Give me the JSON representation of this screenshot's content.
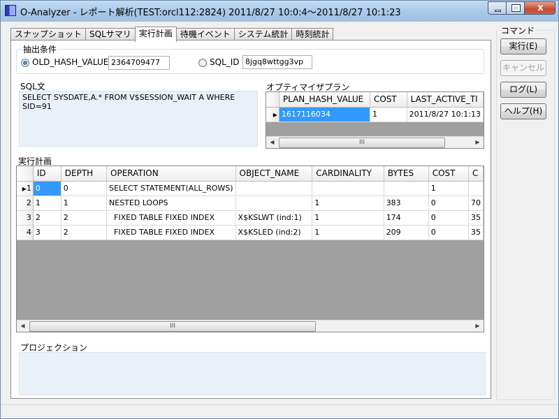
{
  "window": {
    "title": "O-Analyzer - レポート解析(TEST:orcl112:2824) 2011/8/27 10:0:4～2011/8/27 10:1:23",
    "min_glyph": "",
    "close_glyph": "x"
  },
  "tabs": [
    {
      "label": "スナップショット"
    },
    {
      "label": "SQLサマリ"
    },
    {
      "label": "実行計画"
    },
    {
      "label": "待機イベント"
    },
    {
      "label": "システム統計"
    },
    {
      "label": "時刻統計"
    }
  ],
  "conditions": {
    "legend": "抽出条件",
    "old_hash_label": "OLD_HASH_VALUE",
    "old_hash_value": "2364709477",
    "sql_id_label": "SQL_ID",
    "sql_id_value": "8jgq8wttgg3vp"
  },
  "sql": {
    "label": "SQL文",
    "text": "SELECT SYSDATE,A.* FROM V$SESSION_WAIT A WHERE\nSID=91"
  },
  "optimizer_plan": {
    "label": "オプティマイザプラン",
    "columns": [
      "PLAN_HASH_VALUE",
      "COST",
      "LAST_ACTIVE_TI"
    ],
    "rows": [
      {
        "plan_hash_value": "1617116034",
        "cost": "1",
        "last_active": "2011/8/27 10:1:13"
      }
    ]
  },
  "execution_plan": {
    "label": "実行計画",
    "columns": [
      "ID",
      "DEPTH",
      "OPERATION",
      "OBJECT_NAME",
      "CARDINALITY",
      "BYTES",
      "COST",
      "C"
    ],
    "rows": [
      {
        "row": "1",
        "id": "0",
        "depth": "0",
        "operation": "SELECT STATEMENT(ALL_ROWS)",
        "object_name": "",
        "cardinality": "",
        "bytes": "",
        "cost": "1",
        "extra": ""
      },
      {
        "row": "2",
        "id": "1",
        "depth": "1",
        "operation": "NESTED LOOPS",
        "object_name": "",
        "cardinality": "1",
        "bytes": "383",
        "cost": "0",
        "extra": "70"
      },
      {
        "row": "3",
        "id": "2",
        "depth": "2",
        "operation": "FIXED TABLE FIXED INDEX",
        "object_name": "X$KSLWT (ind:1)",
        "cardinality": "1",
        "bytes": "174",
        "cost": "0",
        "extra": "35"
      },
      {
        "row": "4",
        "id": "3",
        "depth": "2",
        "operation": "FIXED TABLE FIXED INDEX",
        "object_name": "X$KSLED (ind:2)",
        "cardinality": "1",
        "bytes": "209",
        "cost": "0",
        "extra": "35"
      }
    ]
  },
  "projection": {
    "label": "プロジェクション"
  },
  "commands": {
    "legend": "コマンド",
    "execute": "実行(E)",
    "cancel": "キャンセル",
    "log": "ログ(L)",
    "help": "ヘルプ(H)"
  },
  "scroll": {
    "left_arrow": "◀",
    "right_arrow": "▶",
    "thumb_grip": "III"
  },
  "row_marker": "▶"
}
